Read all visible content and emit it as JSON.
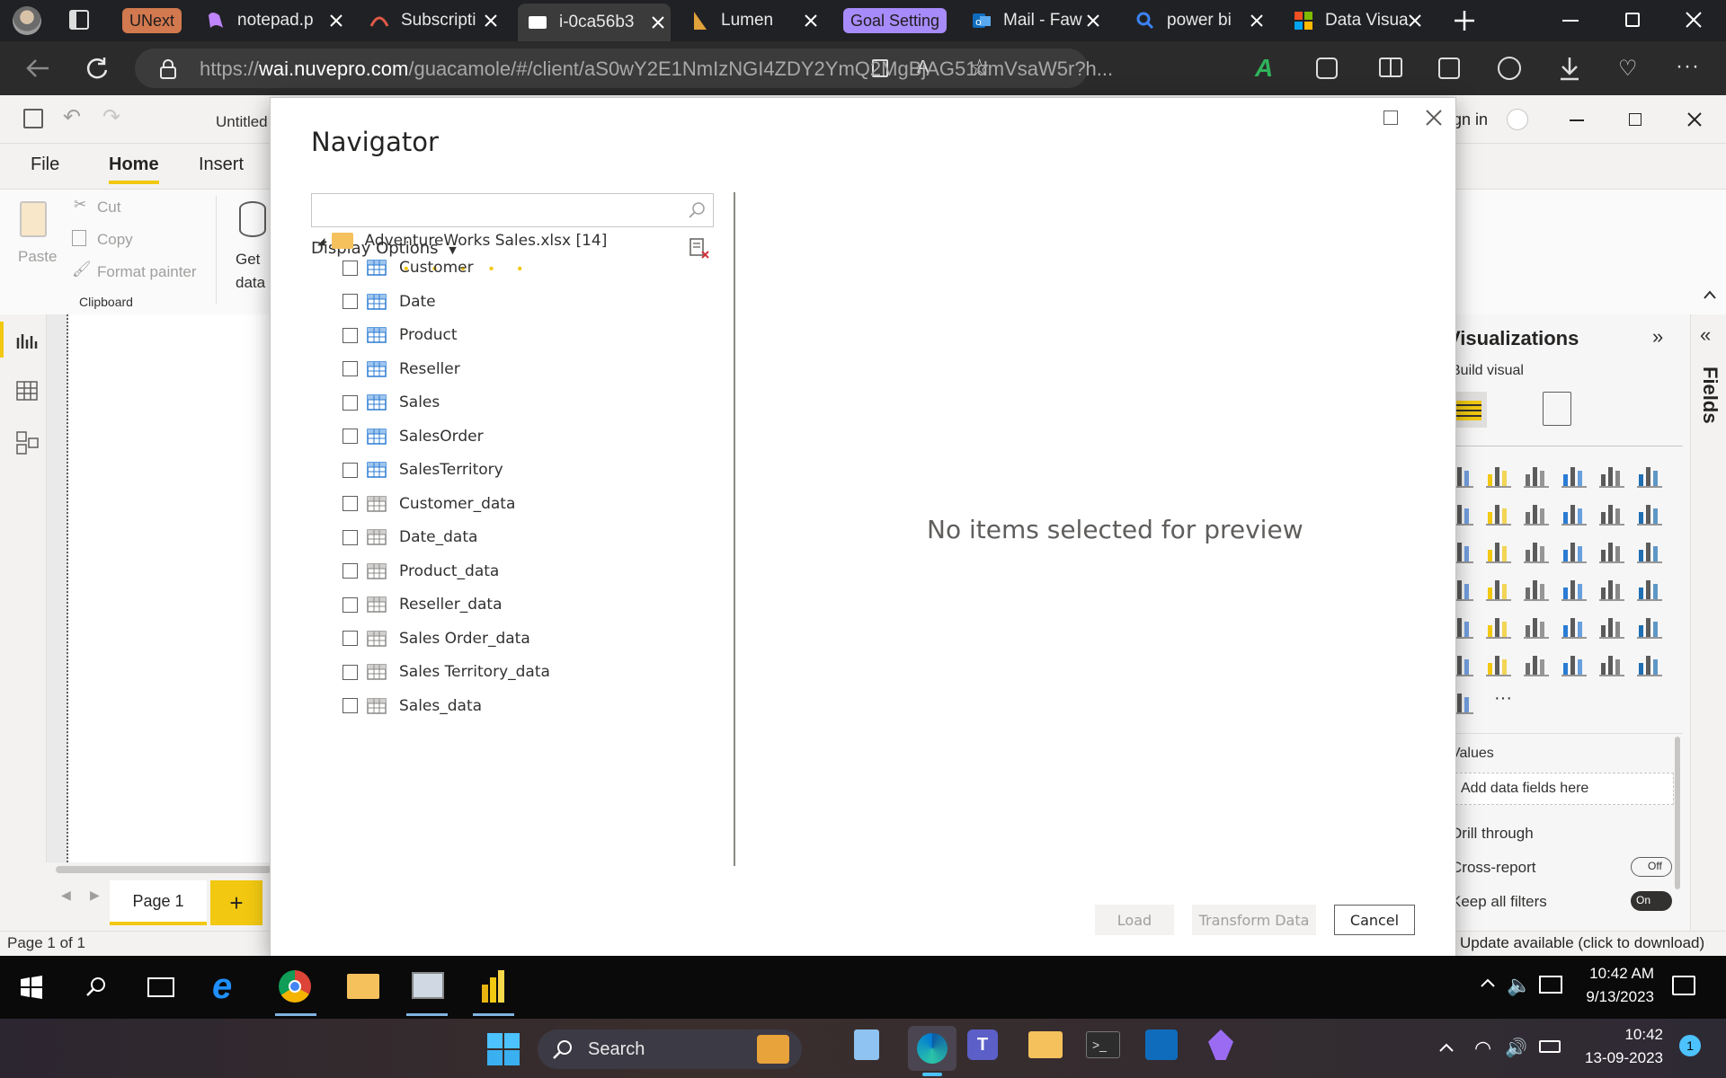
{
  "browser": {
    "tabs": [
      {
        "label": "UNext",
        "kind": "group",
        "color": "#d3794f"
      },
      {
        "label": "notepad.p"
      },
      {
        "label": "Subscripti"
      },
      {
        "label": "i-0ca56b3"
      },
      {
        "label": "Lumen"
      },
      {
        "label": "Goal Setting",
        "kind": "group",
        "color": "#a78bfa"
      },
      {
        "label": "Mail - Faw"
      },
      {
        "label": "power bi"
      },
      {
        "label": "Data Visua"
      }
    ],
    "url_prefix": "https://",
    "url_domain": "wai.nuvepro.com",
    "url_rest": "/guacamole/#/client/aS0wY2E1NmIzNGI4ZDY2YmQ2MgBjAG51dmVsaW5r?h..."
  },
  "pbi": {
    "title": "Untitled",
    "sign_in": "Sign in",
    "ribbon_tabs": [
      "File",
      "Home",
      "Insert"
    ],
    "clipboard": {
      "paste": "Paste",
      "cut": "Cut",
      "copy": "Copy",
      "format_painter": "Format painter",
      "group": "Clipboard"
    },
    "get_data": "Get data",
    "page_tab": "Page 1",
    "status": "Page 1 of 1",
    "update": "Update available (click to download)",
    "vis": {
      "title": "Visualizations",
      "build_visual": "Build visual",
      "fields": "Fields",
      "values": "Values",
      "add_fields": "Add data fields here",
      "drill_through": "Drill through",
      "cross_report": "Cross-report",
      "cross_report_state": "Off",
      "keep_filters": "Keep all filters",
      "keep_filters_state": "On"
    }
  },
  "navigator": {
    "title": "Navigator",
    "search_placeholder": "",
    "display_options": "Display Options",
    "root": "AdventureWorks Sales.xlsx [14]",
    "items": [
      {
        "label": "Customer",
        "type": "table"
      },
      {
        "label": "Date",
        "type": "table"
      },
      {
        "label": "Product",
        "type": "table"
      },
      {
        "label": "Reseller",
        "type": "table"
      },
      {
        "label": "Sales",
        "type": "table"
      },
      {
        "label": "SalesOrder",
        "type": "table"
      },
      {
        "label": "SalesTerritory",
        "type": "table"
      },
      {
        "label": "Customer_data",
        "type": "sheet"
      },
      {
        "label": "Date_data",
        "type": "sheet"
      },
      {
        "label": "Product_data",
        "type": "sheet"
      },
      {
        "label": "Reseller_data",
        "type": "sheet"
      },
      {
        "label": "Sales Order_data",
        "type": "sheet"
      },
      {
        "label": "Sales Territory_data",
        "type": "sheet"
      },
      {
        "label": "Sales_data",
        "type": "sheet"
      }
    ],
    "preview_message": "No items selected for preview",
    "load": "Load",
    "transform": "Transform Data",
    "cancel": "Cancel"
  },
  "taskbar": {
    "time1": "10:42 AM",
    "date1": "9/13/2023",
    "search": "Search",
    "time2": "10:42",
    "date2": "13-09-2023",
    "notif_count": "1"
  },
  "colors": {
    "pbi_yellow": "#f2c811",
    "edge_blue": "#0078d4"
  }
}
